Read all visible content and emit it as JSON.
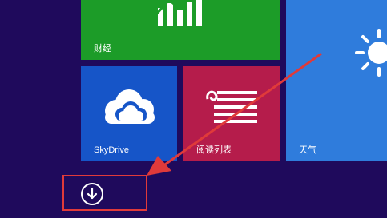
{
  "tiles": {
    "finance": {
      "label": "财经",
      "color": "#1c9c28",
      "icon": "finance-chart-icon"
    },
    "skydrive": {
      "label": "SkyDrive",
      "color": "#1655c8",
      "icon": "cloud-icon"
    },
    "reading_list": {
      "label": "阅读列表",
      "color": "#b51c4b",
      "icon": "reading-list-icon"
    },
    "weather": {
      "label": "天气",
      "color": "#2f7cdc",
      "icon": "sun-icon"
    }
  },
  "all_apps_button": {
    "icon": "down-arrow-circle-icon"
  },
  "annotation": {
    "highlight_color": "#e03a3a",
    "arrow_color": "#e03a3a"
  },
  "background_color": "#1f0a5c"
}
